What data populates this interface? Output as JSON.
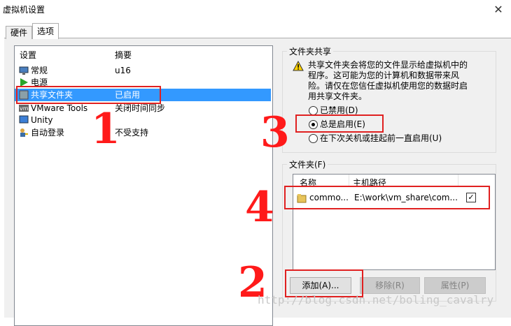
{
  "window": {
    "title": "虚拟机设置"
  },
  "tabs": [
    {
      "label": "硬件"
    },
    {
      "label": "选项"
    }
  ],
  "left_list": {
    "columns": {
      "setting": "设置",
      "summary": "摘要"
    },
    "items": [
      {
        "name": "常规",
        "summary": "u16",
        "icon": "monitor-icon"
      },
      {
        "name": "电源",
        "summary": "",
        "icon": "play-icon"
      },
      {
        "name": "共享文件夹",
        "summary": "已启用",
        "icon": "shared-folder-icon"
      },
      {
        "name": "VMware Tools",
        "summary": "关闭时间同步",
        "icon": "vm-icon"
      },
      {
        "name": "Unity",
        "summary": "",
        "icon": "unity-icon"
      },
      {
        "name": "自动登录",
        "summary": "不受支持",
        "icon": "user-key-icon"
      }
    ]
  },
  "shared_folders": {
    "group_title": "文件夹共享",
    "warning": "共享文件夹会将您的文件显示给虚拟机中的程序。这可能为您的计算机和数据带来风险。请仅在您信任虚拟机使用您的数据时启用共享文件夹。",
    "options": [
      {
        "label": "已禁用(D)",
        "selected": false
      },
      {
        "label": "总是启用(E)",
        "selected": true
      },
      {
        "label": "在下次关机或挂起前一直启用(U)",
        "selected": false
      }
    ]
  },
  "folders": {
    "group_title": "文件夹(F)",
    "columns": {
      "name": "名称",
      "path": "主机路径"
    },
    "rows": [
      {
        "name": "commo...",
        "path": "E:\\work\\vm_share\\com...",
        "checked": true
      }
    ],
    "buttons": {
      "add": "添加(A)...",
      "remove": "移除(R)",
      "properties": "属性(P)"
    }
  },
  "annotations": {
    "n1": "1",
    "n2": "2",
    "n3": "3",
    "n4": "4",
    "accent": "#e02020"
  },
  "watermark": "http://blog.csdn.net/boling_cavalry"
}
